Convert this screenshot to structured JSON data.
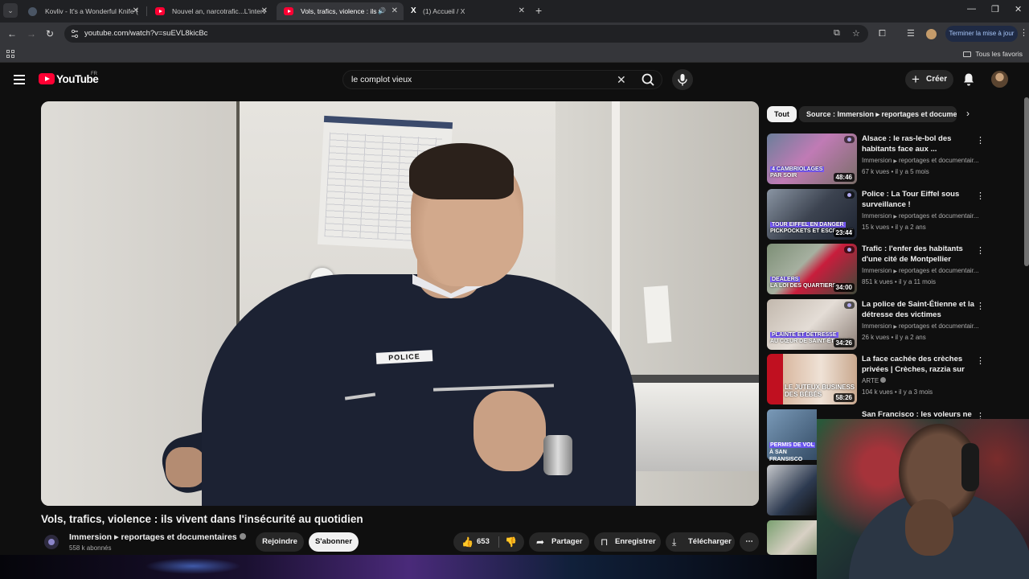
{
  "browser": {
    "tabs": [
      {
        "title": "Kovliv - It's a Wonderful Knife (",
        "icon": "knife-icon"
      },
      {
        "title": "Nouvel an, narcotrafic...L'interv",
        "icon": "youtube-icon"
      },
      {
        "title": "Vols, trafics, violence : ils viv",
        "icon": "youtube-icon"
      },
      {
        "title": "(1) Accueil / X",
        "icon": "x-icon"
      }
    ],
    "url": "youtube.com/watch?v=suEVL8kicBc",
    "update_button": "Terminer la mise à jour",
    "bookmarks_all": "Tous les favoris"
  },
  "youtube": {
    "logo_text": "YouTube",
    "country": "FR",
    "search_value": "le complot vieux",
    "create_label": "Créer"
  },
  "video": {
    "badge_text": "POLICE",
    "title": "Vols, trafics, violence : ils vivent dans l'insécurité au quotidien",
    "channel": "Immersion",
    "channel_suffix": "reportages et documentaires",
    "subscribers": "558 k abonnés",
    "join_label": "Rejoindre",
    "subscribe_label": "S'abonner",
    "likes": "653",
    "share_label": "Partager",
    "save_label": "Enregistrer",
    "download_label": "Télécharger"
  },
  "chips": [
    {
      "label": "Tout",
      "active": true
    },
    {
      "label": "Source : Immersion ▸ reportages et documentaires",
      "active": false
    }
  ],
  "recommendations": [
    {
      "title": "Alsace : le ras-le-bol des habitants face aux ...",
      "channel": "Immersion",
      "channel_suffix": "reportages et documentair...",
      "meta": "67 k vues • il y a 5 mois",
      "duration": "48:46",
      "thumb_text_1": "4 CAMBRIOLAGES",
      "thumb_text_2": "PAR SOIR"
    },
    {
      "title": "Police : La Tour Eiffel sous surveillance !",
      "channel": "Immersion",
      "channel_suffix": "reportages et documentair...",
      "meta": "15 k vues • il y a 2 ans",
      "duration": "23:44",
      "thumb_text_1": "TOUR EIFFEL EN DANGER",
      "thumb_text_2": "PICKPOCKETS ET ESCROQUE"
    },
    {
      "title": "Trafic : l'enfer des habitants d'une cité de Montpellier",
      "channel": "Immersion",
      "channel_suffix": "reportages et documentair...",
      "meta": "851 k vues • il y a 11 mois",
      "duration": "34:00",
      "thumb_text_1": "DEALERS",
      "thumb_text_2": "LA LOI DES QUARTIERS"
    },
    {
      "title": "La police de Saint-Étienne et la détresse des victimes",
      "channel": "Immersion",
      "channel_suffix": "reportages et documentair...",
      "meta": "26 k vues • il y a 2 ans",
      "duration": "34:26",
      "thumb_text_1": "PLAINTE ET DÉTRESSE",
      "thumb_text_2": "AU CŒUR DE SAINT-ÉTIENNE"
    },
    {
      "title": "La face cachée des crèches privées | Crèches, razzia sur le...",
      "channel": "ARTE",
      "channel_suffix": "",
      "meta": "104 k vues • il y a 3 mois",
      "duration": "58:26",
      "thumb_text_1": "LE JUTEUX BUSINESS",
      "thumb_text_2": "DES BÉBÉS"
    },
    {
      "title": "San Francisco : les voleurs ne",
      "channel": "",
      "channel_suffix": "",
      "meta": "",
      "duration": "",
      "thumb_text_1": "PERMIS DE VOL",
      "thumb_text_2": "À SAN FRANSISCO"
    }
  ],
  "colors": {
    "youtube_red": "#ff0033",
    "background": "#0f0f0f",
    "chip_active": "#f1f1f1"
  }
}
